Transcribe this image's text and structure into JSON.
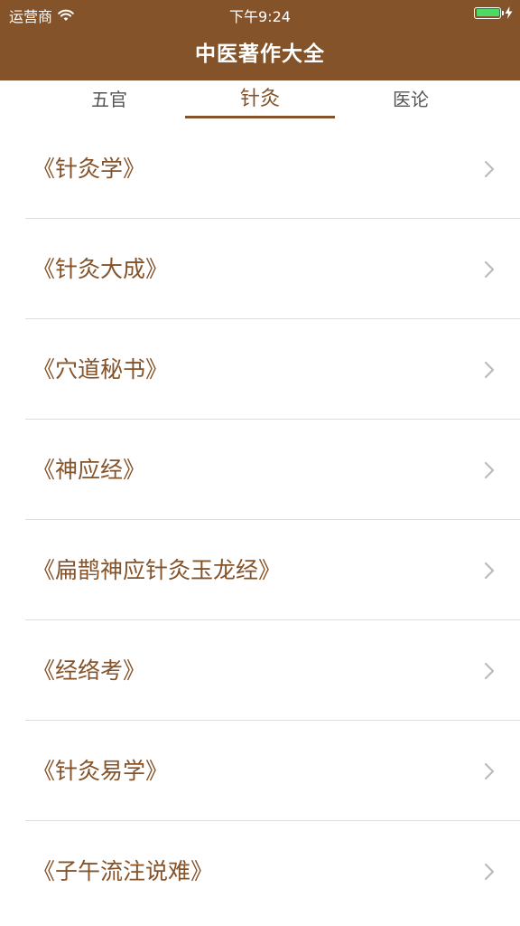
{
  "status_bar": {
    "carrier": "运营商",
    "time": "下午9:24",
    "battery_level": 1.0,
    "colors": {
      "battery": "#4cd964"
    }
  },
  "nav": {
    "title": "中医著作大全",
    "background": "#84532a"
  },
  "tabs": [
    {
      "label": "五官",
      "selected": false
    },
    {
      "label": "针灸",
      "selected": true
    },
    {
      "label": "医论",
      "selected": false
    }
  ],
  "list": {
    "items": [
      {
        "title": "《针灸学》"
      },
      {
        "title": "《针灸大成》"
      },
      {
        "title": "《穴道秘书》"
      },
      {
        "title": "《神应经》"
      },
      {
        "title": "《扁鹊神应针灸玉龙经》"
      },
      {
        "title": "《经络考》"
      },
      {
        "title": "《针灸易学》"
      },
      {
        "title": "《子午流注说难》"
      }
    ],
    "accessory_icon": "chevron-right-icon"
  },
  "colors": {
    "accent": "#84532a",
    "tab_inactive": "#555555",
    "divider": "#dddddd",
    "chevron": "#bbbbbb"
  }
}
